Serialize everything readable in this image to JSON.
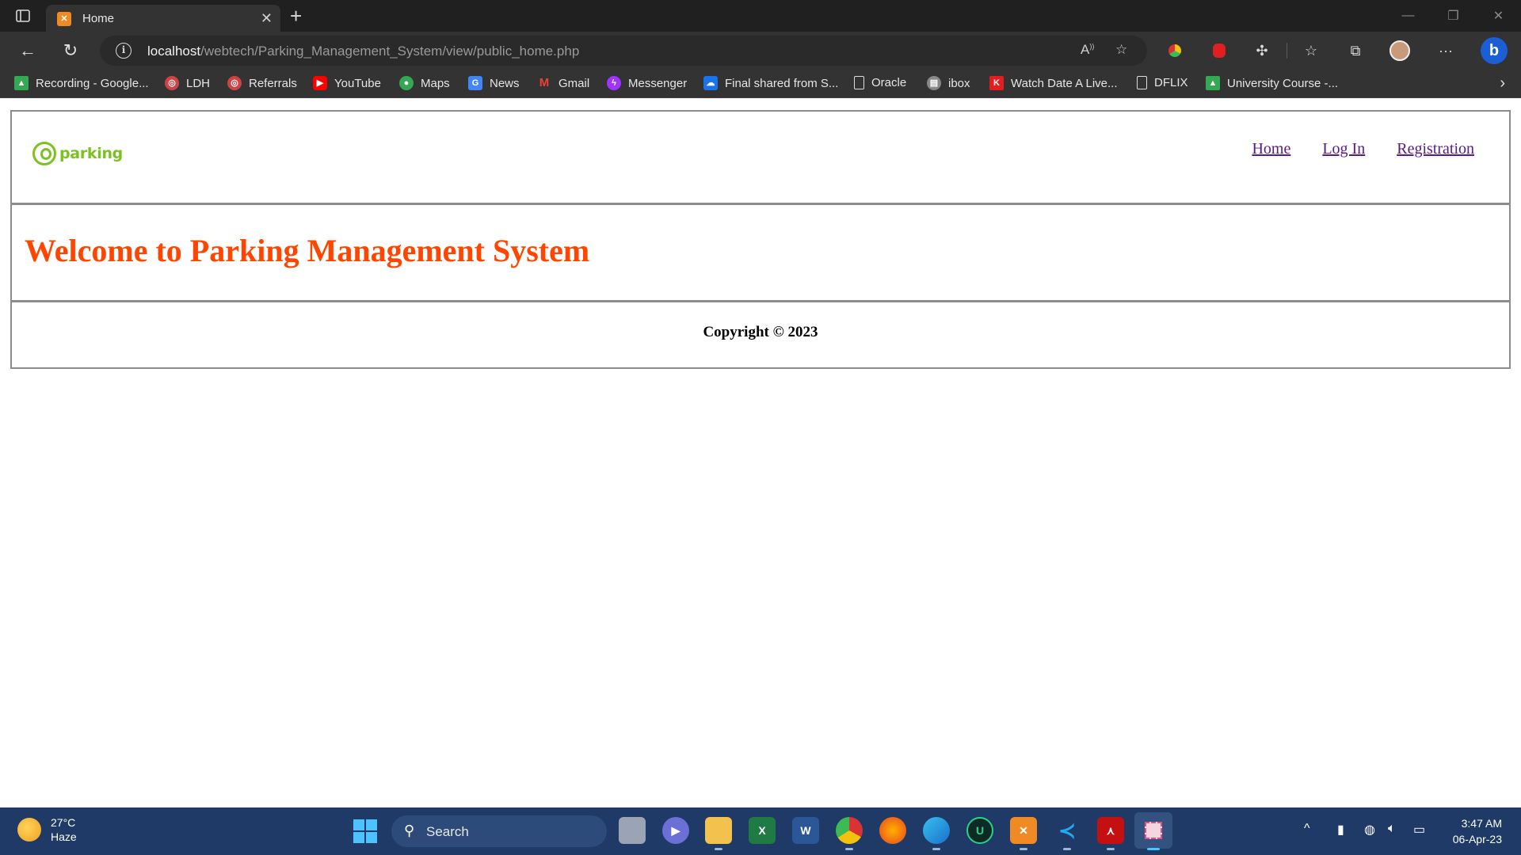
{
  "browser": {
    "tab": {
      "title": "Home",
      "favicon": "xampp-icon"
    },
    "address": {
      "host": "localhost",
      "path": "/webtech/Parking_Management_System/view/public_home.php"
    },
    "bookmarks": [
      {
        "label": "Recording - Google...",
        "icon": "google-drive-icon",
        "color": "#34a853"
      },
      {
        "label": "LDH",
        "icon": "ldh-icon",
        "color": "#d33"
      },
      {
        "label": "Referrals",
        "icon": "referrals-icon",
        "color": "#d33"
      },
      {
        "label": "YouTube",
        "icon": "youtube-icon",
        "color": "#ff0000"
      },
      {
        "label": "Maps",
        "icon": "maps-icon",
        "color": "#ea4335"
      },
      {
        "label": "News",
        "icon": "news-icon",
        "color": "#4285f4"
      },
      {
        "label": "Gmail",
        "icon": "gmail-icon",
        "color": "#ea4335"
      },
      {
        "label": "Messenger",
        "icon": "messenger-icon",
        "color": "#a033ff"
      },
      {
        "label": "Final shared from S...",
        "icon": "cloud-icon",
        "color": "#1a73e8"
      },
      {
        "label": "Oracle",
        "icon": "page-icon",
        "color": "#333333"
      },
      {
        "label": "ibox",
        "icon": "ibox-icon",
        "color": "#888888"
      },
      {
        "label": "Watch Date A Live...",
        "icon": "anime-icon",
        "color": "#e02020"
      },
      {
        "label": "DFLIX",
        "icon": "page-icon",
        "color": "#333333"
      },
      {
        "label": "University Course -...",
        "icon": "google-drive-icon",
        "color": "#34a853"
      }
    ]
  },
  "site": {
    "logo_text": "parking",
    "nav": [
      {
        "label": "Home"
      },
      {
        "label": "Log In"
      },
      {
        "label": "Registration"
      }
    ],
    "welcome": "Welcome to Parking Management System",
    "copyright": "Copyright © 2023"
  },
  "taskbar": {
    "weather_temp": "27°C",
    "weather_desc": "Haze",
    "search_label": "Search",
    "time": "3:47 AM",
    "date": "06-Apr-23"
  },
  "colors": {
    "heading": "#ff4500",
    "logo": "#7cc21e",
    "link": "#1a0dab",
    "link_visited": "#551a8b",
    "taskbar": "#1f3a66"
  }
}
